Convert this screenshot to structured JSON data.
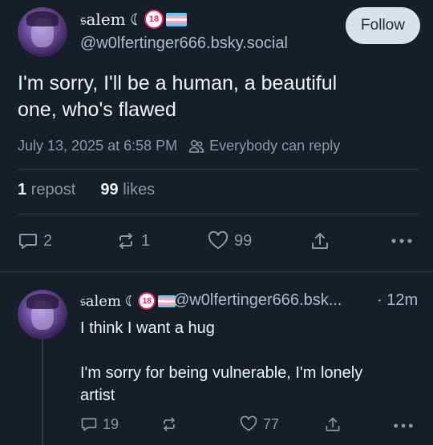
{
  "main_post": {
    "display_name": "𝔰alem ☾",
    "badge_18": "18",
    "handle": "@w0lfertinger666.bsky.social",
    "follow_label": "Follow",
    "text": "I'm sorry, I'll be a human, a beautiful\none, who's flawed",
    "timestamp": "July 13, 2025 at 6:58 PM",
    "reply_setting": "Everybody can reply",
    "repost_count": "1",
    "repost_label": "repost",
    "like_count": "99",
    "like_label": "likes",
    "actions": {
      "reply_count": "2",
      "repost_count": "1",
      "like_count": "99"
    }
  },
  "reply_post": {
    "display_name": "𝔰alem ☾",
    "badge_18": "18",
    "handle": "@w0lfertinger666.bsk...",
    "time_ago": "· 12m",
    "text": "I think I want a hug\n\nI'm sorry for being vulnerable, I'm lonely\nartist",
    "actions": {
      "reply_count": "19",
      "repost_count": "",
      "like_count": "77"
    }
  },
  "colors": {
    "background": "#161e27",
    "text_primary": "#f1f3f5",
    "text_secondary": "#8b98a5",
    "divider": "#2e3a47",
    "follow_button_bg": "#d9e1e9"
  },
  "icons": [
    "chat-bubble-icon",
    "repost-icon",
    "heart-icon",
    "share-icon",
    "more-icon",
    "people-icon"
  ]
}
